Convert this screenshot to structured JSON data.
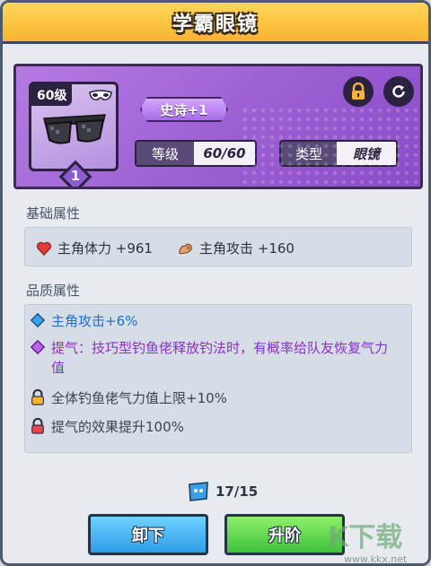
{
  "title": "学霸眼镜",
  "item": {
    "level_badge": "60级",
    "rank": "1",
    "rarity": "史诗+1",
    "level_label": "等级",
    "level_value": "60/60",
    "type_label": "类型",
    "type_value": "眼镜"
  },
  "basic": {
    "heading": "基础属性",
    "attrs": [
      {
        "icon": "heart-icon",
        "text": "主角体力 +961"
      },
      {
        "icon": "arm-flex-icon",
        "text": "主角攻击 +160"
      }
    ]
  },
  "quality": {
    "heading": "品质属性",
    "lines": [
      {
        "icon": "blue-diamond-icon",
        "text": "主角攻击+6%",
        "color": "#1e6fcc"
      },
      {
        "icon": "purple-diamond-icon",
        "text": "提气：技巧型钓鱼佬释放钓法时，有概率给队友恢复气力值",
        "color": "#8a2fc9"
      },
      {
        "icon": "yellow-lock-icon",
        "text": "全体钓鱼佬气力值上限+10%",
        "color": "#3b4350"
      },
      {
        "icon": "red-lock-icon",
        "text": "提气的效果提升100%",
        "color": "#3b4350"
      }
    ]
  },
  "materials": {
    "count": "17/15"
  },
  "buttons": {
    "unequip": "卸下",
    "upgrade": "升阶"
  },
  "watermark": {
    "logo": "K下载",
    "url": "www.kkx.net"
  },
  "colors": {
    "title_bar": "#f7b52c",
    "card": "#9c5fd3",
    "unequip": "#2e9ee8",
    "upgrade": "#3fc23a"
  }
}
